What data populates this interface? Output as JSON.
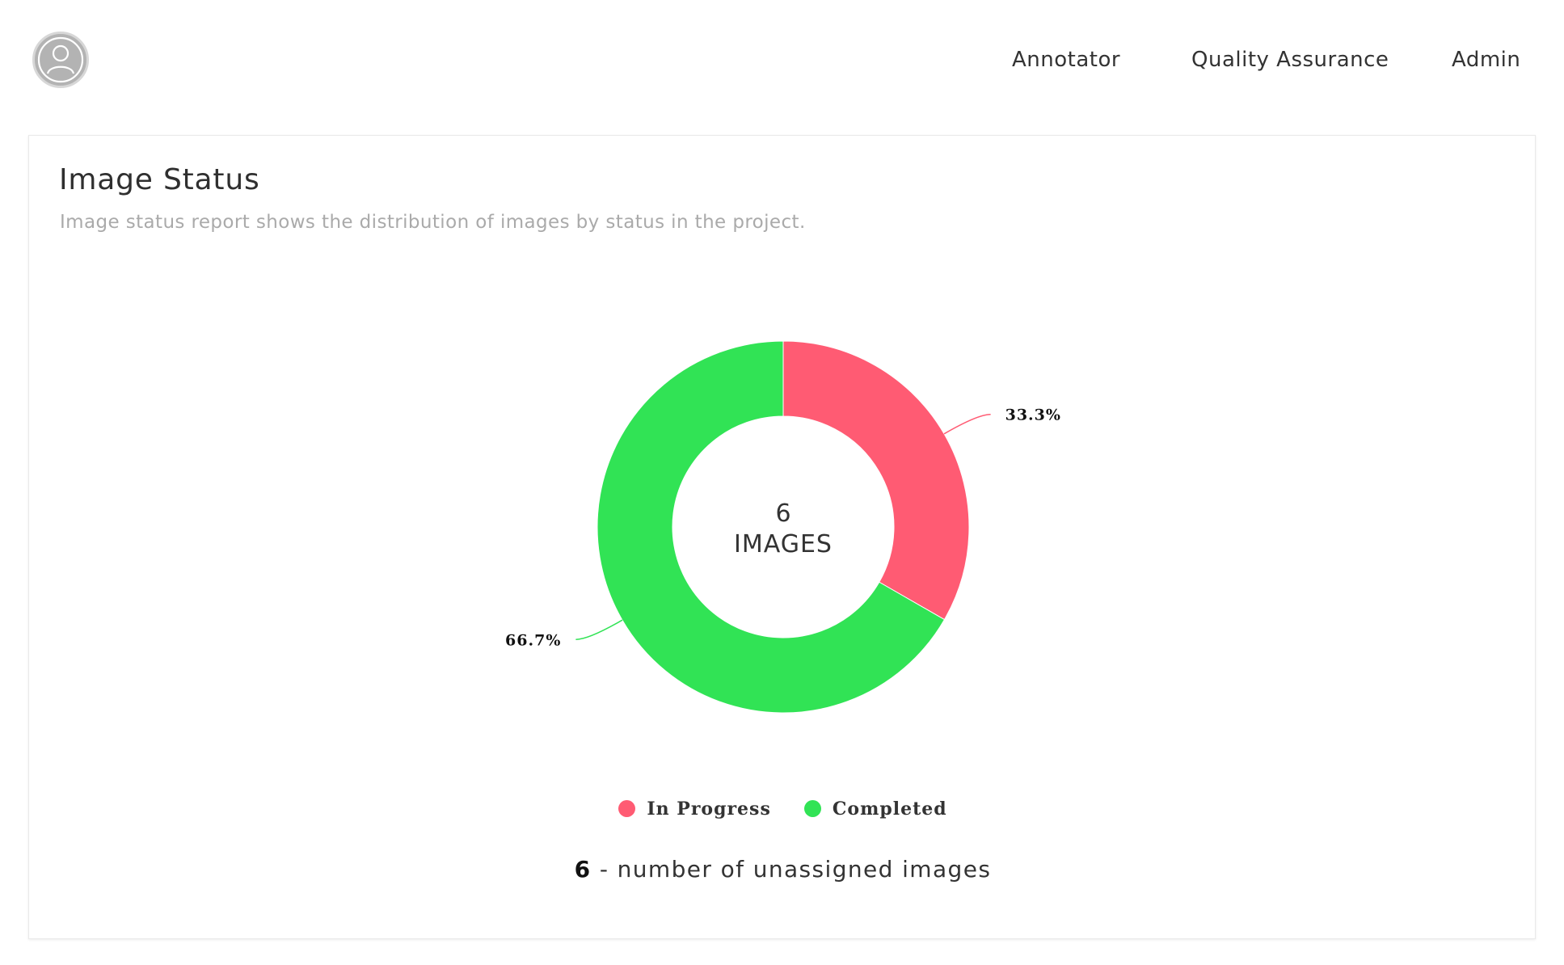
{
  "header": {
    "avatar_icon": "user-icon",
    "nav": [
      {
        "label": "Annotator"
      },
      {
        "label": "Quality Assurance"
      },
      {
        "label": "Admin"
      }
    ]
  },
  "report": {
    "title": "Image Status",
    "subtitle": "Image status report shows the distribution of images by status in the project.",
    "center_count": "6",
    "center_label": "IMAGES",
    "unassigned_count": "6",
    "unassigned_text": " - number of unassigned images"
  },
  "chart_data": {
    "type": "pie",
    "donut": true,
    "categories": [
      "In Progress",
      "Completed"
    ],
    "values": [
      33.3,
      66.7
    ],
    "labels": [
      "33.3%",
      "66.7%"
    ],
    "colors": [
      "#ff5b73",
      "#31e355"
    ],
    "legend": "bottom"
  }
}
